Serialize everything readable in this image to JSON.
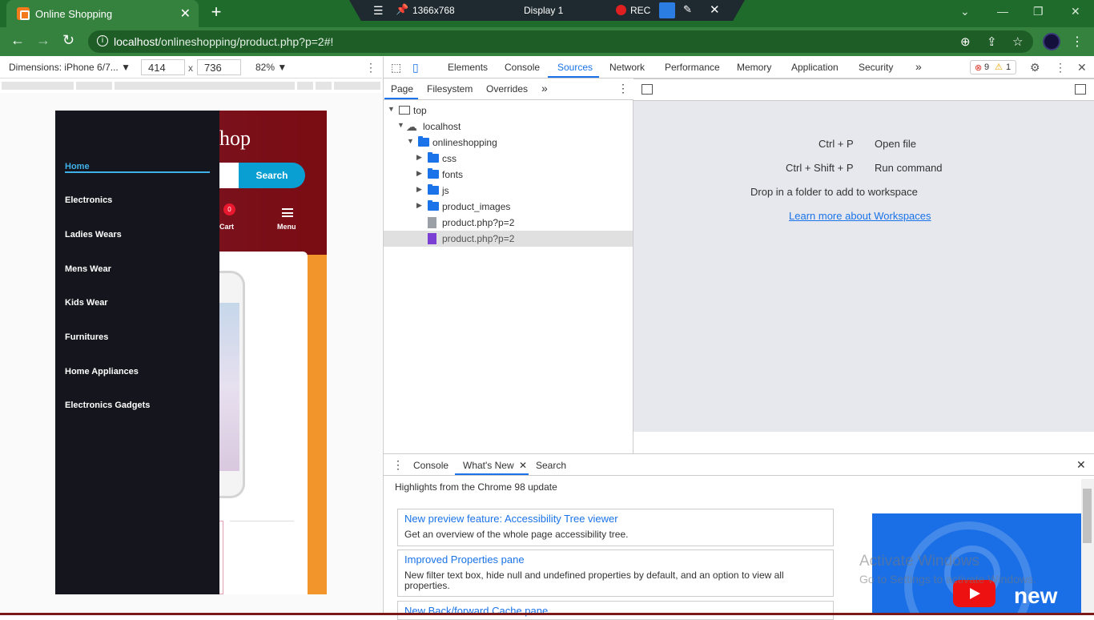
{
  "browser": {
    "tab_title": "Online Shopping",
    "tab_close": "✕",
    "new_tab": "+",
    "url_host": "localhost",
    "url_path": "/onlineshopping/product.php?p=2#!"
  },
  "recorder": {
    "resolution": "1366x768",
    "display": "Display 1",
    "rec_label": "REC"
  },
  "device_toolbar": {
    "dimensions_label": "Dimensions: iPhone 6/7...",
    "width": "414",
    "height": "736",
    "times": "x",
    "zoom": "82%"
  },
  "phone_page": {
    "shop_title": "hop",
    "search_button": "Search",
    "cart_count": "0",
    "cart_label": "Cart",
    "menu_label": "Menu",
    "nav_items": [
      "Home",
      "Electronics",
      "Ladies Wears",
      "Mens Wear",
      "Kids Wear",
      "Furnitures",
      "Home Appliances",
      "Electronics Gadgets"
    ]
  },
  "devtools": {
    "tabs": [
      "Elements",
      "Console",
      "Sources",
      "Network",
      "Performance",
      "Memory",
      "Application",
      "Security"
    ],
    "more_tabs": "»",
    "errors": "9",
    "warnings": "1",
    "sub_tabs": [
      "Page",
      "Filesystem",
      "Overrides"
    ],
    "tree": [
      {
        "label": "top"
      },
      {
        "label": "localhost"
      },
      {
        "label": "onlineshopping"
      },
      {
        "label": "css"
      },
      {
        "label": "fonts"
      },
      {
        "label": "js"
      },
      {
        "label": "product_images"
      },
      {
        "label": "product.php?p=2"
      },
      {
        "label": "product.php?p=2"
      }
    ],
    "shortcuts": [
      {
        "keys": "Ctrl + P",
        "action": "Open file"
      },
      {
        "keys": "Ctrl + Shift + P",
        "action": "Run command"
      }
    ],
    "drop_text": "Drop in a folder to add to workspace",
    "learn_more": "Learn more about Workspaces",
    "drawer_tabs": [
      "Console",
      "What's New",
      "Search"
    ],
    "highlights": "Highlights from the Chrome 98 update",
    "cards": [
      {
        "title": "New preview feature: Accessibility Tree viewer",
        "desc": "Get an overview of the whole page accessibility tree."
      },
      {
        "title": "Improved Properties pane",
        "desc": "New filter text box, hide null and undefined properties by default, and an option to view all properties."
      },
      {
        "title": "New Back/forward Cache pane",
        "desc": ""
      }
    ],
    "video_text": "new"
  },
  "watermark": {
    "line1": "Activate Windows",
    "line2": "Go to Settings to activate Windows."
  }
}
